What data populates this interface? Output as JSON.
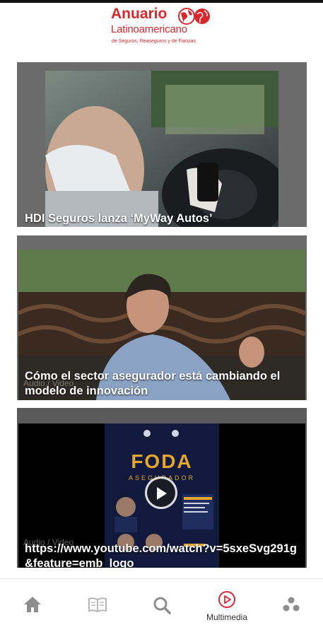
{
  "header": {
    "logo_title": "Anuario",
    "logo_subtitle": "Latinoamericano",
    "logo_tagline": "de Seguros, Reaseguros y de Fianzas",
    "brand_color": "#d9272e"
  },
  "articles": [
    {
      "title": "HDI Seguros lanza ‘MyWay Autos’",
      "kind": ""
    },
    {
      "title": "Cómo el sector asegurador está cambiando el modelo de innovación",
      "kind": "Audio / Video"
    },
    {
      "title": "https://www.youtube.com/watch?v=5sxeSvg291g&feature=emb_logo",
      "kind": "Audio / Video",
      "poster_title": "FODA",
      "poster_subtitle": "ASEGURADOR"
    }
  ],
  "bottom_nav": {
    "items": [
      {
        "icon": "home-icon",
        "label": ""
      },
      {
        "icon": "book-icon",
        "label": ""
      },
      {
        "icon": "search-icon",
        "label": ""
      },
      {
        "icon": "play-circle-icon",
        "label": "Multimedia",
        "active": true
      },
      {
        "icon": "more-dots-icon",
        "label": ""
      }
    ],
    "active_color": "#d9272e",
    "inactive_color": "#9a9a9a"
  }
}
